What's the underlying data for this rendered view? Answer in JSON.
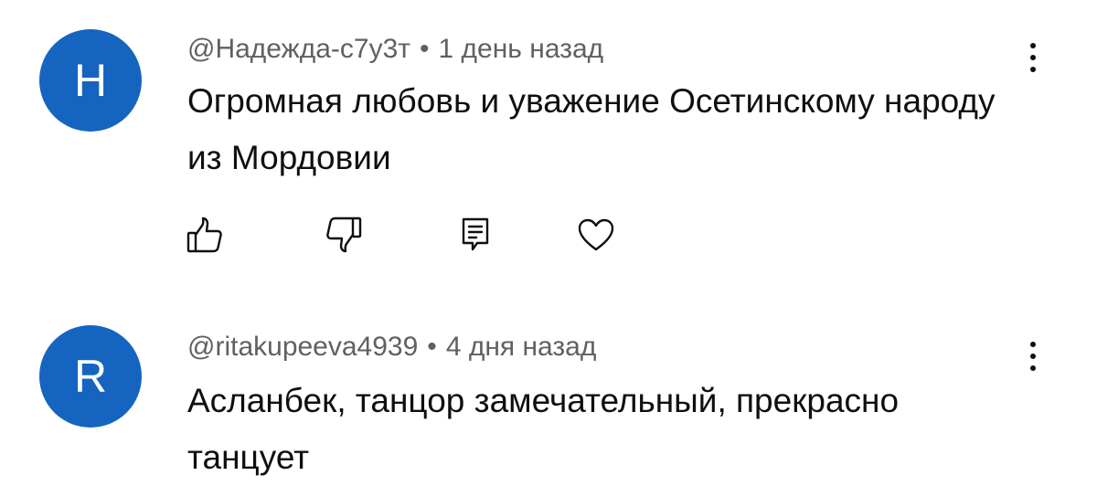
{
  "comments": [
    {
      "avatar_letter": "H",
      "author": "@Надежда-с7у3т",
      "separator": "•",
      "time": "1 день назад",
      "text": "Огромная любовь и уважение Осетинскому народу из Мордовии",
      "actions": [
        "thumbs-up-icon",
        "thumbs-down-icon",
        "reply-icon",
        "heart-icon"
      ]
    },
    {
      "avatar_letter": "R",
      "author": "@ritakupeeva4939",
      "separator": "•",
      "time": "4 дня назад",
      "text": "Асланбек, танцор замечательный, прекрасно танцует"
    }
  ],
  "colors": {
    "avatar": "#1565c0",
    "meta_text": "#606060",
    "body_text": "#0f0f0f"
  }
}
